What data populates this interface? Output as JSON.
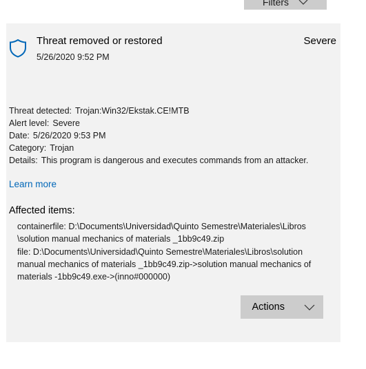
{
  "toolbar": {
    "filters_label": "Filters"
  },
  "threat": {
    "title": "Threat removed or restored",
    "date": "5/26/2020 9:52 PM",
    "severity": "Severe",
    "details": [
      {
        "key": "Threat detected:",
        "value": "Trojan:Win32/Ekstak.CE!MTB"
      },
      {
        "key": "Alert level:",
        "value": "Severe"
      },
      {
        "key": "Date:",
        "value": "5/26/2020 9:53 PM"
      },
      {
        "key": "Category:",
        "value": "Trojan"
      },
      {
        "key": "Details:",
        "value": "This program is dangerous and executes commands from an attacker."
      }
    ],
    "learn_more": "Learn more",
    "affected_title": "Affected items:",
    "affected_items": [
      {
        "line1": "containerfile: D:\\Documents\\Universidad\\Quinto Semestre\\Materiales\\Libros",
        "line2": "\\solution manual mechanics of materials _1bb9c49.zip",
        "line3": ""
      },
      {
        "line1": "file: D:\\Documents\\Universidad\\Quinto Semestre\\Materiales\\Libros\\solution",
        "line2": "manual mechanics of materials _1bb9c49.zip->solution manual mechanics of",
        "line3": "materials -1bb9c49.exe->(inno#000000)"
      }
    ],
    "actions_label": "Actions"
  },
  "icons": {
    "shield": "shield-icon",
    "chevron": "chevron-down-icon"
  },
  "colors": {
    "accent": "#0067b8",
    "card_bg": "#f2f2f2",
    "button_bg": "#cccccc"
  }
}
